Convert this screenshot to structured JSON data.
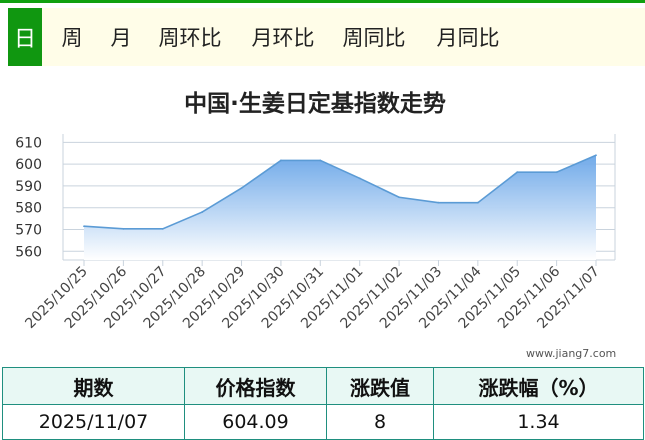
{
  "tabs": [
    {
      "label": "日",
      "active": true
    },
    {
      "label": "周"
    },
    {
      "label": "月"
    },
    {
      "label": "周环比"
    },
    {
      "label": "月环比"
    },
    {
      "label": "周同比"
    },
    {
      "label": "月同比"
    }
  ],
  "chart_data": {
    "type": "area",
    "title": "中国·生姜日定基指数走势",
    "categories": [
      "2025/10/25",
      "2025/10/26",
      "2025/10/27",
      "2025/10/28",
      "2025/10/29",
      "2025/10/30",
      "2025/10/31",
      "2025/11/01",
      "2025/11/02",
      "2025/11/03",
      "2025/11/04",
      "2025/11/05",
      "2025/11/06",
      "2025/11/07"
    ],
    "series": [
      {
        "values": [
          571.5,
          570.3,
          570.3,
          578.0,
          589.0,
          601.7,
          601.7,
          593.5,
          584.8,
          582.3,
          582.3,
          596.3,
          596.3,
          604.09
        ]
      }
    ],
    "y_ticks": [
      560,
      570,
      580,
      590,
      600,
      610
    ],
    "ylim": [
      556,
      612
    ],
    "grid": true,
    "colors": {
      "line": "#5b9bd5",
      "fill_top": "#6aa6e8",
      "fill_bottom": "#ffffff"
    }
  },
  "watermark": "www.jiang7.com",
  "table": {
    "headers": [
      "期数",
      "价格指数",
      "涨跌值",
      "涨跌幅（%）"
    ],
    "row": [
      "2025/11/07",
      "604.09",
      "8",
      "1.34"
    ]
  }
}
